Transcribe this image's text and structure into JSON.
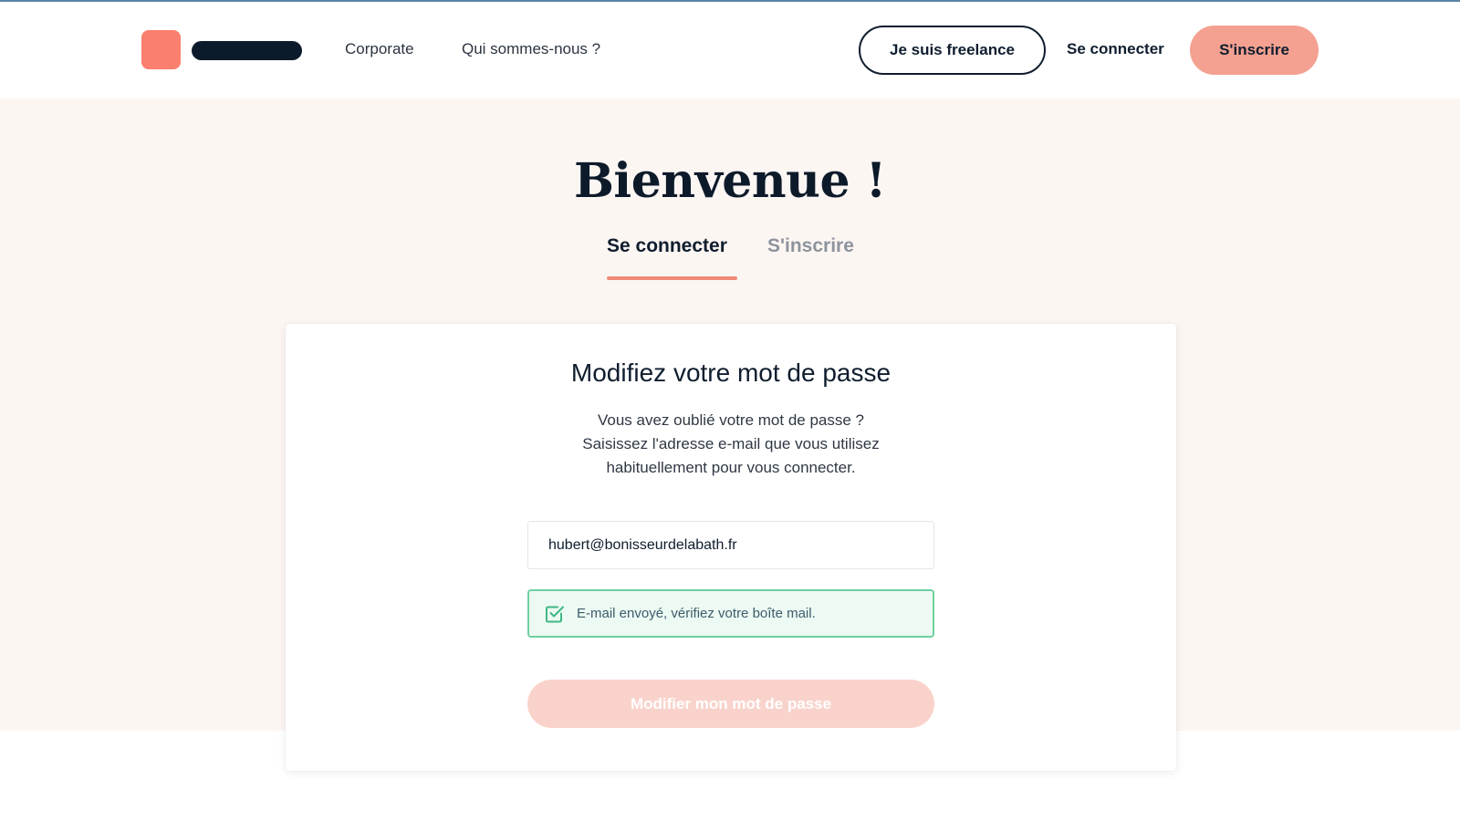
{
  "header": {
    "nav": {
      "corporate": "Corporate",
      "about": "Qui sommes-nous ?"
    },
    "freelance_button": "Je suis freelance",
    "login_link": "Se connecter",
    "signup_button": "S'inscrire"
  },
  "hero": {
    "title": "Bienvenue !",
    "tabs": {
      "login": "Se connecter",
      "signup": "S'inscrire"
    },
    "active_tab": "login"
  },
  "reset_card": {
    "title": "Modifiez votre mot de passe",
    "description": {
      "line1": "Vous avez oublié votre mot de passe ?",
      "line2": "Saisissez l'adresse e-mail que vous utilisez",
      "line3": "habituellement pour vous connecter."
    },
    "email_value": "hubert@bonisseurdelabath.fr",
    "success_message": "E-mail envoyé, vérifiez votre boîte mail.",
    "submit_label": "Modifier mon mot de passe",
    "submit_disabled": true
  },
  "colors": {
    "brand_coral": "#fb7f6e",
    "primary_button": "#f4a191",
    "navy": "#0f1d2e",
    "hero_background": "#fcf6f3",
    "success_border": "#6fd0a0",
    "success_background": "#ecfaf3"
  },
  "icons": {
    "alert": "check-square-icon"
  }
}
